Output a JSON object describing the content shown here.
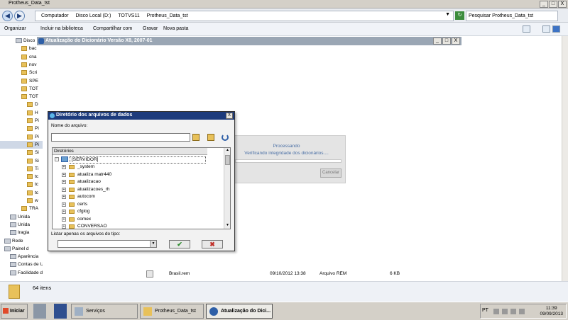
{
  "explorer": {
    "title": "Protheus_Data_tst",
    "window_buttons": [
      "_",
      "□",
      "X"
    ],
    "nav": {
      "back": "◀",
      "forward": "▶"
    },
    "address": [
      "Computador",
      "Disco Local (D:)",
      "TOTVS11",
      "Protheus_Data_tst"
    ],
    "search_placeholder": "Pesquisar Protheus_Data_tst",
    "toolbar": [
      "Organizar",
      "Incluir na biblioteca",
      "Compartilhar com",
      "Gravar",
      "Nova pasta"
    ],
    "sidebar": [
      {
        "label": "Disco",
        "kind": "drive"
      },
      {
        "label": "bac",
        "kind": "folder"
      },
      {
        "label": "cna",
        "kind": "folder"
      },
      {
        "label": "nov",
        "kind": "folder"
      },
      {
        "label": "Scri",
        "kind": "folder"
      },
      {
        "label": "SPE",
        "kind": "folder"
      },
      {
        "label": "TOT",
        "kind": "folder"
      },
      {
        "label": "TOT",
        "kind": "folder"
      },
      {
        "label": "D",
        "kind": "folder"
      },
      {
        "label": "H",
        "kind": "folder"
      },
      {
        "label": "Pi",
        "kind": "folder"
      },
      {
        "label": "Pi",
        "kind": "folder"
      },
      {
        "label": "Pi",
        "kind": "folder"
      },
      {
        "label": "Pi",
        "kind": "folder",
        "selected": true
      },
      {
        "label": "Si",
        "kind": "folder"
      },
      {
        "label": "Si",
        "kind": "folder"
      },
      {
        "label": "Ti",
        "kind": "folder"
      },
      {
        "label": "tc",
        "kind": "folder"
      },
      {
        "label": "tc",
        "kind": "folder"
      },
      {
        "label": "tc",
        "kind": "folder"
      },
      {
        "label": "w",
        "kind": "folder"
      },
      {
        "label": "TRA",
        "kind": "folder"
      },
      {
        "label": "Unida",
        "kind": "drive"
      },
      {
        "label": "Unida",
        "kind": "drive"
      },
      {
        "label": "Iragia",
        "kind": "drive"
      },
      {
        "label": "Rede",
        "kind": "net"
      },
      {
        "label": "Painel d",
        "kind": "cp"
      },
      {
        "label": "Aparência",
        "kind": "cp"
      },
      {
        "label": "Contas de Usuário",
        "kind": "cp"
      },
      {
        "label": "Facilidade de Acesso",
        "kind": "cp"
      }
    ],
    "file_row": {
      "name": "Brasil.rem",
      "date": "09/10/2012 13:38",
      "type": "Arquivo REM",
      "size": "6 KB"
    },
    "status_count": "64 itens"
  },
  "update_window": {
    "title": "Atualização do Dicionário Versão X8, 2007-01",
    "window_buttons": [
      "_",
      "□",
      "X"
    ],
    "process_title": "Processando",
    "process_msg": "Verificando integridade dos dicionários....",
    "cancel_label": "Cancelar"
  },
  "dialog": {
    "title": "Diretório dos arquivos de dados",
    "close": "X",
    "filename_label": "Nome do arquivo:",
    "filename_value": "",
    "dirs_label": "Diretórios",
    "root": "[SERVIDOR]",
    "folders": [
      "_system",
      "atualiza matr440",
      "atualizacao",
      "atualizacoes_rh",
      "autocom",
      "certs",
      "cfglog",
      "comex",
      "CONVERSAO"
    ],
    "type_label": "Listar apenas os arquivos do tipo:",
    "type_value": "",
    "ok_glyph": "✔",
    "cancel_glyph": "✖"
  },
  "taskbar": {
    "start": "Iniciar",
    "buttons": [
      {
        "label": "Serviços",
        "active": false
      },
      {
        "label": "Protheus_Data_tst",
        "active": false
      },
      {
        "label": "Atualização do Dici...",
        "active": true
      }
    ],
    "lang": "PT",
    "time": "11:39",
    "date": "09/09/2013"
  },
  "colors": {
    "accent": "#1d3b7c",
    "process_text": "#4a6fa5",
    "folder": "#e8c15a"
  }
}
